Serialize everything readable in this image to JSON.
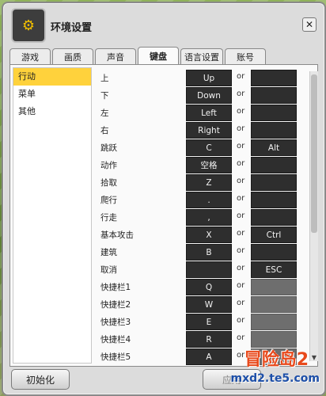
{
  "window": {
    "title": "环境设置",
    "close_symbol": "✕"
  },
  "tabs": [
    {
      "label": "游戏",
      "active": false
    },
    {
      "label": "画质",
      "active": false
    },
    {
      "label": "声音",
      "active": false
    },
    {
      "label": "键盘",
      "active": true
    },
    {
      "label": "语言设置",
      "active": false
    },
    {
      "label": "账号",
      "active": false
    }
  ],
  "sidebar": {
    "items": [
      {
        "label": "行动",
        "selected": true
      },
      {
        "label": "菜单",
        "selected": false
      },
      {
        "label": "其他",
        "selected": false
      }
    ]
  },
  "or_text": "or",
  "bindings": [
    {
      "label": "上",
      "key1": "Up",
      "key2": ""
    },
    {
      "label": "下",
      "key1": "Down",
      "key2": ""
    },
    {
      "label": "左",
      "key1": "Left",
      "key2": ""
    },
    {
      "label": "右",
      "key1": "Right",
      "key2": ""
    },
    {
      "label": "跳跃",
      "key1": "C",
      "key2": "Alt"
    },
    {
      "label": "动作",
      "key1": "空格",
      "key2": ""
    },
    {
      "label": "拾取",
      "key1": "Z",
      "key2": ""
    },
    {
      "label": "爬行",
      "key1": ".",
      "key2": ""
    },
    {
      "label": "行走",
      "key1": ",",
      "key2": ""
    },
    {
      "label": "基本攻击",
      "key1": "X",
      "key2": "Ctrl"
    },
    {
      "label": "建筑",
      "key1": "B",
      "key2": ""
    },
    {
      "label": "取消",
      "key1": "",
      "key2": "ESC"
    },
    {
      "label": "快捷栏1",
      "key1": "Q",
      "key2": "",
      "key2_disabled": true
    },
    {
      "label": "快捷栏2",
      "key1": "W",
      "key2": "",
      "key2_disabled": true
    },
    {
      "label": "快捷栏3",
      "key1": "E",
      "key2": "",
      "key2_disabled": true
    },
    {
      "label": "快捷栏4",
      "key1": "R",
      "key2": "",
      "key2_disabled": true
    },
    {
      "label": "快捷栏5",
      "key1": "A",
      "key2": "",
      "key2_disabled": true
    }
  ],
  "buttons": {
    "init": "初始化",
    "apply": "应用"
  },
  "watermark": {
    "logo": "冒险岛2",
    "site": "mxd2.te5.com"
  }
}
